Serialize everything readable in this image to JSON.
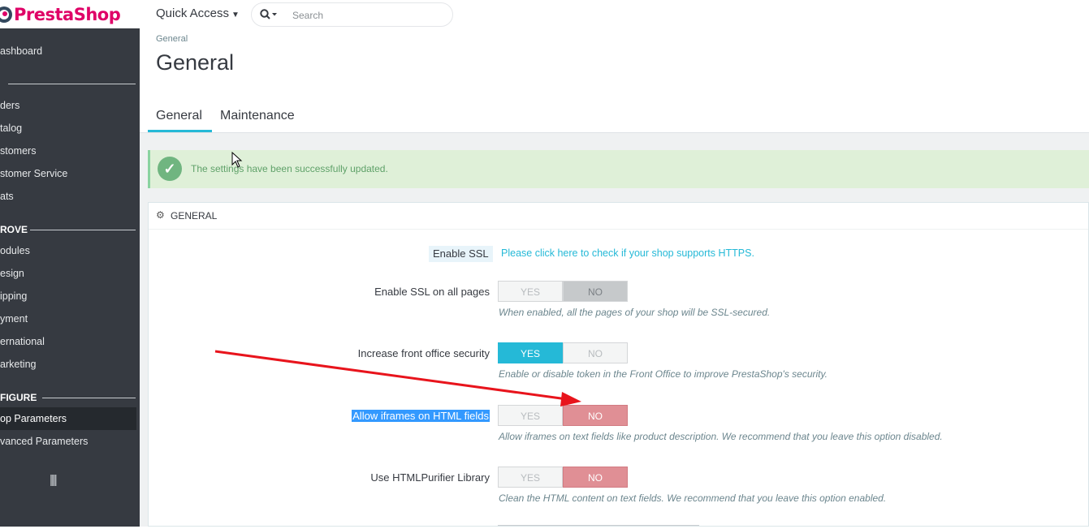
{
  "brand": {
    "part1": "Presta",
    "part2": "Shop"
  },
  "header": {
    "quick_access": "Quick Access",
    "search_placeholder": "Search"
  },
  "sidebar": {
    "items": [
      {
        "label": "ashboard"
      },
      {
        "label": "ders"
      },
      {
        "label": "talog"
      },
      {
        "label": "stomers"
      },
      {
        "label": "stomer Service"
      },
      {
        "label": "ats"
      },
      {
        "label": "odules"
      },
      {
        "label": "esign"
      },
      {
        "label": "ipping"
      },
      {
        "label": "yment"
      },
      {
        "label": "ernational"
      },
      {
        "label": "arketing"
      },
      {
        "label": "op Parameters"
      },
      {
        "label": "vanced Parameters"
      }
    ],
    "sections": [
      {
        "label": "ROVE"
      },
      {
        "label": "FIGURE"
      }
    ],
    "collapse_icon": "||||"
  },
  "breadcrumb": "General",
  "page_title": "General",
  "tabs": [
    {
      "label": "General"
    },
    {
      "label": "Maintenance"
    }
  ],
  "alert": {
    "text": "The settings have been successfully updated."
  },
  "panel": {
    "title": "GENERAL",
    "ssl": {
      "label": "Enable SSL",
      "link": "Please click here to check if your shop supports HTTPS."
    },
    "fields": [
      {
        "label": "Enable SSL on all pages",
        "yes": "YES",
        "no": "NO",
        "value": "NO",
        "help": "When enabled, all the pages of your shop will be SSL-secured."
      },
      {
        "label": "Increase front office security",
        "yes": "YES",
        "no": "NO",
        "value": "YES",
        "help": "Enable or disable token in the Front Office to improve PrestaShop's security."
      },
      {
        "label": "Allow iframes on HTML fields",
        "yes": "YES",
        "no": "NO",
        "value": "NO",
        "help": "Allow iframes on text fields like product description. We recommend that you leave this option disabled."
      },
      {
        "label": "Use HTMLPurifier Library",
        "yes": "YES",
        "no": "NO",
        "value": "NO",
        "help": "Clean the HTML content on text fields. We recommend that you leave this option enabled."
      }
    ]
  },
  "colors": {
    "accent": "#25b9d7",
    "brand": "#df0067",
    "danger": "#e08f95",
    "success": "#70b580",
    "arrow": "#e8141c"
  }
}
